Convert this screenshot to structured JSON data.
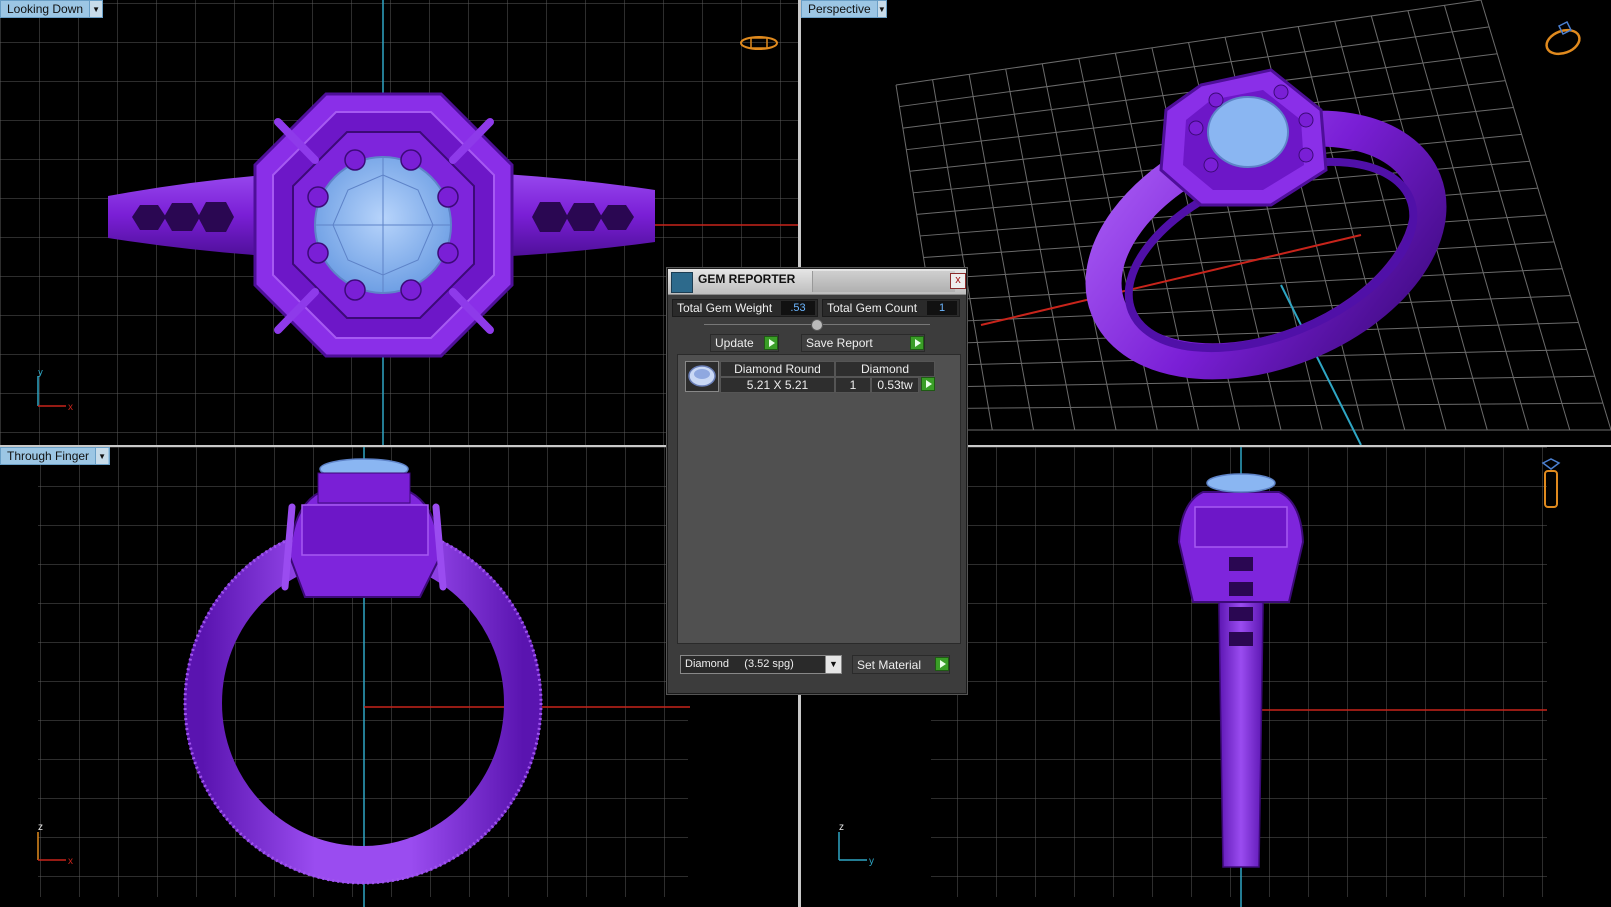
{
  "viewports": {
    "top_left": {
      "label": "Looking Down",
      "axes": {
        "h": "x",
        "v": "y"
      }
    },
    "top_right": {
      "label": "Perspective"
    },
    "bottom_left": {
      "label": "Through Finger",
      "axes": {
        "h": "x",
        "v": "z"
      }
    },
    "bottom_right": {
      "axes": {
        "h": "y",
        "v": "z"
      }
    }
  },
  "colors": {
    "ring_purple": "#7a1fd6",
    "ring_highlight": "#a052f0",
    "gem_blue": "#8ab6f2",
    "grid": "#5a5a5a",
    "axis_cyan": "#2fa6c4",
    "axis_red": "#c8241b",
    "label_bg": "#9cc6e4",
    "go_green": "#3a9e27"
  },
  "gem_reporter": {
    "title": "GEM REPORTER",
    "close": "x",
    "total_weight_label": "Total Gem Weight",
    "total_weight_value": ".53",
    "total_count_label": "Total Gem Count",
    "total_count_value": "1",
    "update_label": "Update",
    "save_report_label": "Save Report",
    "rows": [
      {
        "header_name": "Diamond Round",
        "header_type": "Diamond",
        "size": "5.21 X 5.21",
        "count": "1",
        "weight": "0.53tw"
      }
    ],
    "material_select": "Diamond     (3.52 spg)",
    "set_material_label": "Set Material"
  },
  "icons": {
    "top_left_nav": "ring-top-view-icon",
    "top_right_nav": "ring-perspective-icon",
    "bottom_right_nav": "ring-side-view-icon"
  }
}
